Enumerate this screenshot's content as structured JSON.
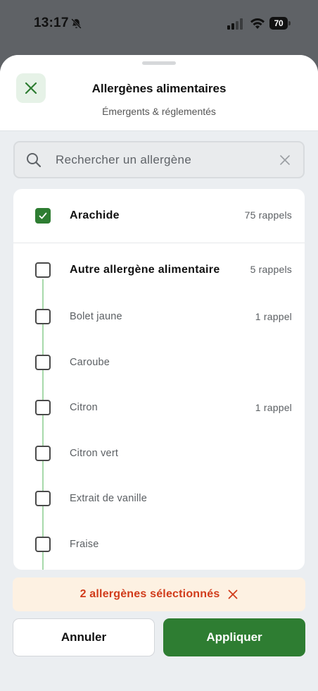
{
  "status_bar": {
    "time": "13:17",
    "battery": "70",
    "icons": [
      "bell-off-icon",
      "signal-icon",
      "wifi-icon",
      "battery-icon"
    ]
  },
  "sheet": {
    "title": "Allergènes alimentaires",
    "subtitle": "Émergents & réglementés"
  },
  "search": {
    "placeholder": "Rechercher un allergène"
  },
  "items": [
    {
      "label": "Arachide",
      "count": "75 rappels",
      "checked": true
    },
    {
      "label": "Autre allergène alimentaire",
      "count": "5 rappels",
      "checked": false
    },
    {
      "label": "Bolet jaune",
      "count": "1 rappel",
      "checked": false
    },
    {
      "label": "Caroube",
      "count": "",
      "checked": false
    },
    {
      "label": "Citron",
      "count": "1 rappel",
      "checked": false
    },
    {
      "label": "Citron vert",
      "count": "",
      "checked": false
    },
    {
      "label": "Extrait de vanille",
      "count": "",
      "checked": false
    },
    {
      "label": "Fraise",
      "count": "",
      "checked": false
    }
  ],
  "banner": {
    "text": "2 allergènes sélectionnés"
  },
  "buttons": {
    "cancel": "Annuler",
    "apply": "Appliquer"
  },
  "colors": {
    "accent": "#2e7d32",
    "banner_text": "#d13b1a",
    "banner_bg": "#fdf1e2"
  }
}
